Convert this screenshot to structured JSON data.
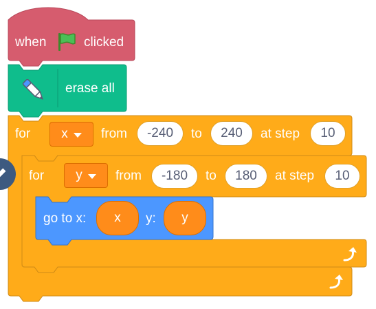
{
  "hat_block": {
    "when_label": "when",
    "flag_icon": "green-flag-icon",
    "clicked_label": "clicked"
  },
  "erase_block": {
    "pen_icon": "pen-icon",
    "label": "erase all"
  },
  "outer_loop": {
    "for_label": "for",
    "variable": "x",
    "from_label": "from",
    "from_value": "-240",
    "to_label": "to",
    "to_value": "240",
    "step_label": "at step",
    "step_value": "10"
  },
  "inner_loop": {
    "for_label": "for",
    "variable": "y",
    "from_label": "from",
    "from_value": "-180",
    "to_label": "to",
    "to_value": "180",
    "step_label": "at step",
    "step_value": "10"
  },
  "goto_block": {
    "label": "go to x:",
    "x_value": "x",
    "y_label": "y:",
    "y_value": "y"
  },
  "colors": {
    "events": "#d65c6e",
    "pen": "#0fbd8c",
    "control": "#ffab19",
    "motion": "#4c97ff",
    "variables": "#ff8c1a"
  }
}
